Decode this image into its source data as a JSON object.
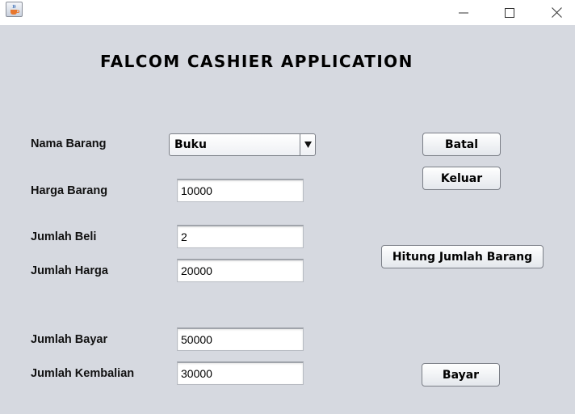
{
  "window": {
    "icon": "java-cup-icon",
    "controls": [
      "minimize-icon",
      "maximize-icon",
      "close-icon"
    ]
  },
  "heading": "FALCOM CASHIER APPLICATION",
  "form": {
    "nama_barang": {
      "label": "Nama Barang",
      "value": "Buku"
    },
    "harga_barang": {
      "label": "Harga Barang",
      "value": "10000"
    },
    "jumlah_beli": {
      "label": "Jumlah Beli",
      "value": "2"
    },
    "jumlah_harga": {
      "label": "Jumlah Harga",
      "value": "20000"
    },
    "jumlah_bayar": {
      "label": "Jumlah Bayar",
      "value": "50000"
    },
    "jumlah_kembalian": {
      "label": "Jumlah Kembalian",
      "value": "30000"
    }
  },
  "buttons": {
    "batal": "Batal",
    "keluar": "Keluar",
    "hitung": "Hitung Jumlah Barang",
    "bayar": "Bayar"
  },
  "colors": {
    "background": "#d6d9e0",
    "titlebar": "#ffffff"
  }
}
